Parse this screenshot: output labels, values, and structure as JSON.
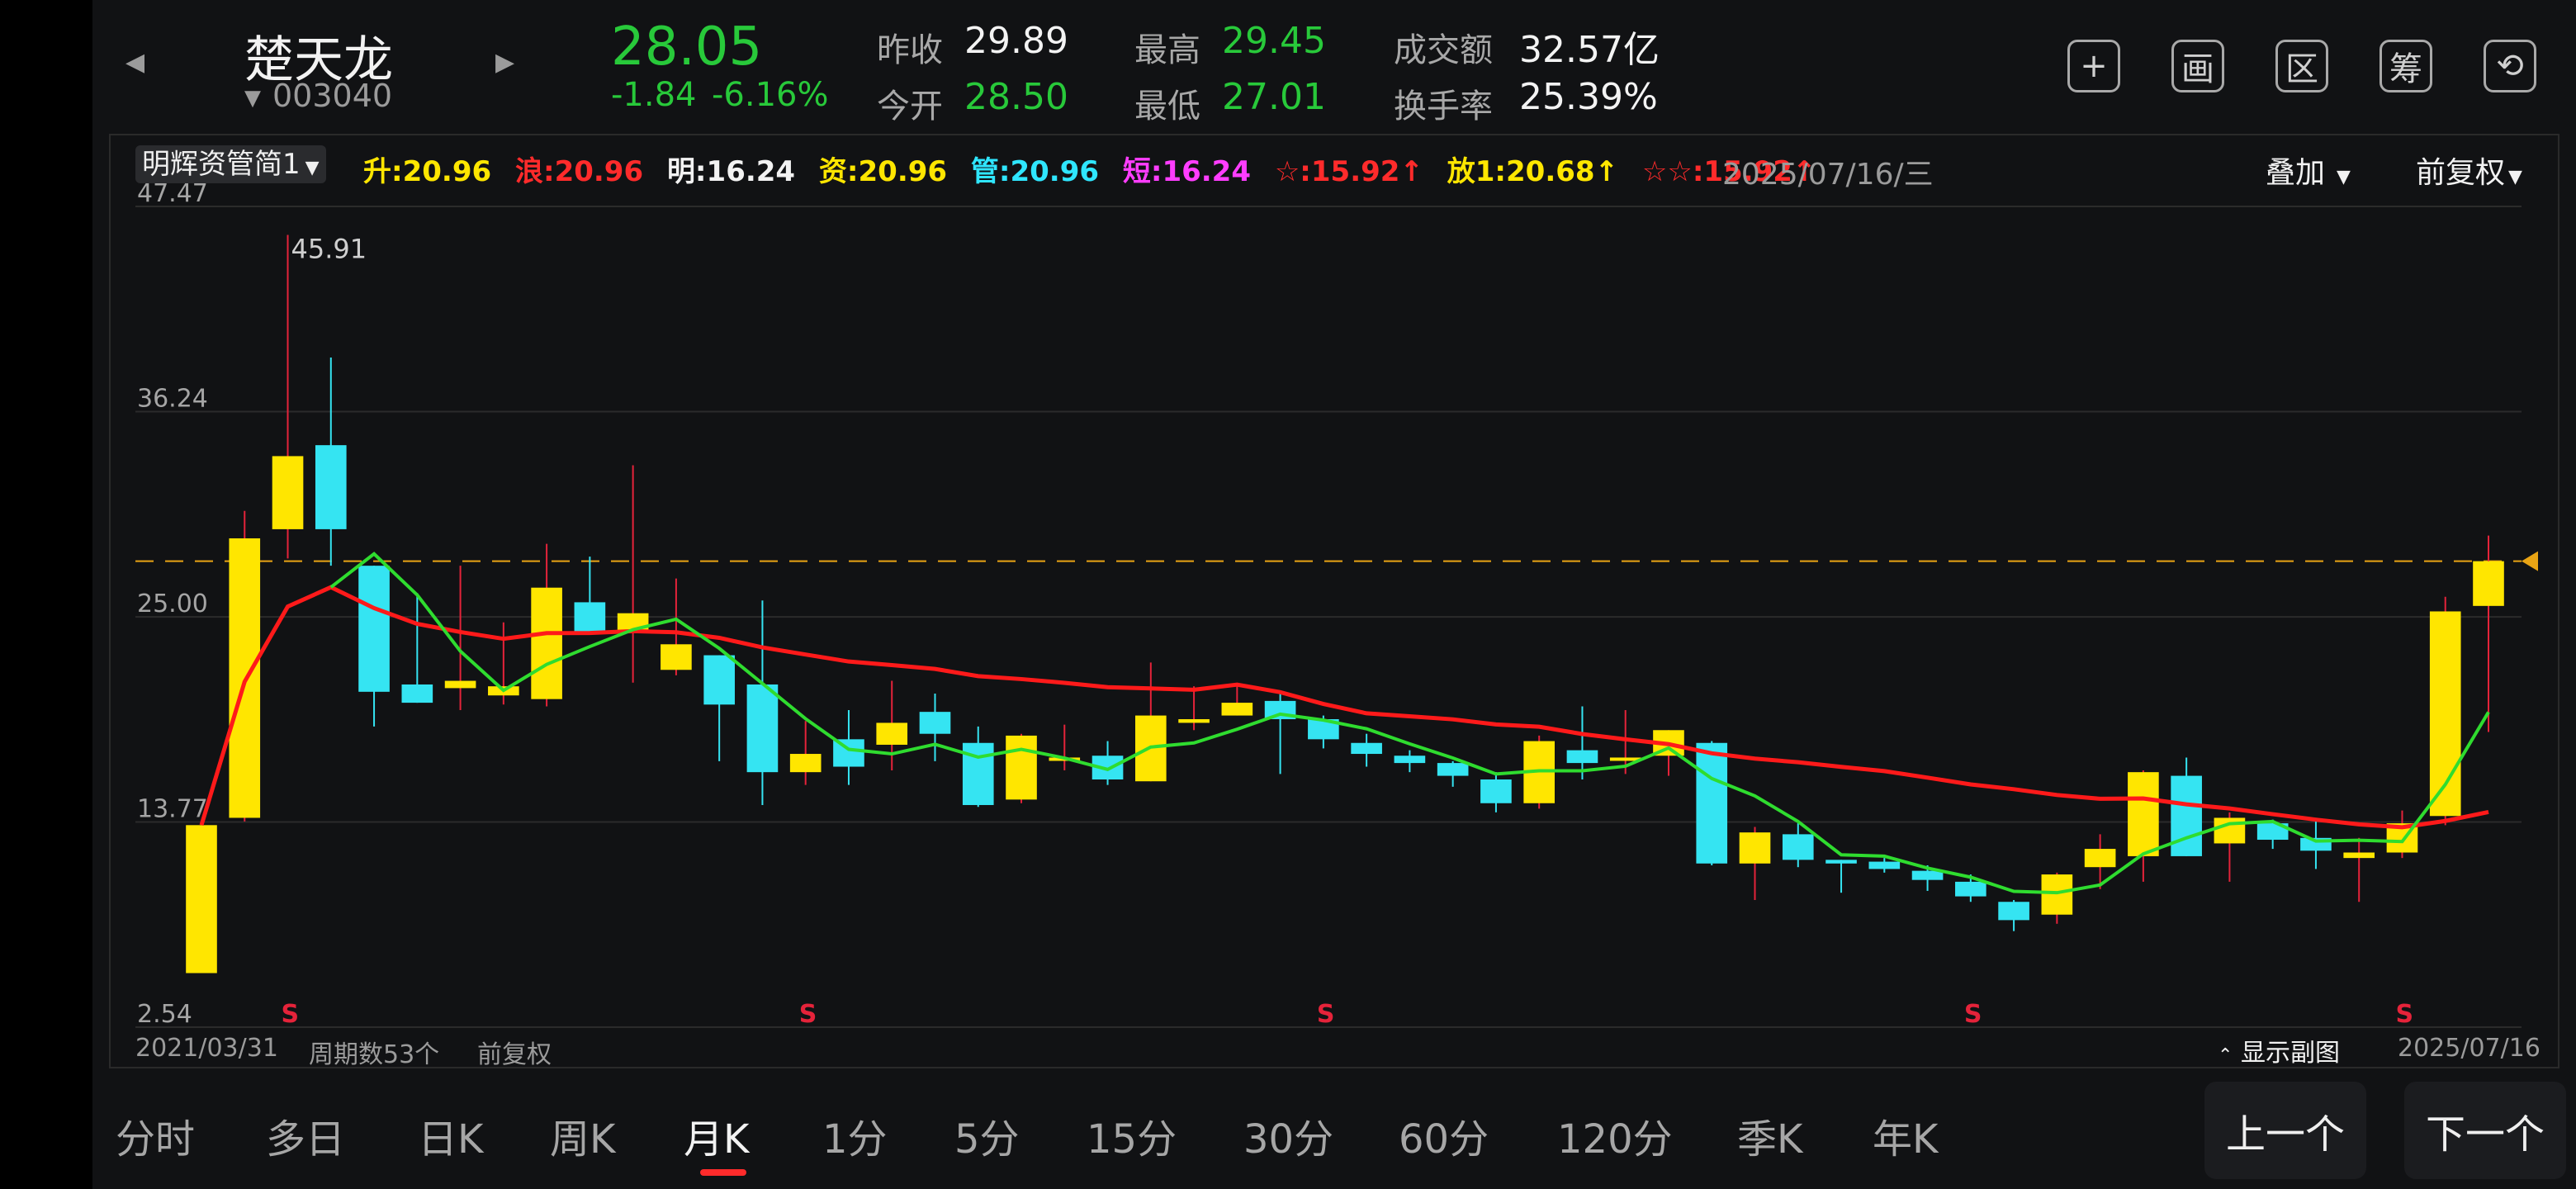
{
  "stock": {
    "name": "楚天龙",
    "code": "003040",
    "price": "28.05",
    "change": "-1.84",
    "change_pct": "-6.16%",
    "prev_close_label": "昨收",
    "prev_close": "29.89",
    "open_label": "今开",
    "open": "28.50",
    "high_label": "最高",
    "high": "29.45",
    "low_label": "最低",
    "low": "27.01",
    "turnover_label": "成交额",
    "turnover": "32.57亿",
    "turnover_rate_label": "换手率",
    "turnover_rate": "25.39%"
  },
  "header_icons": [
    {
      "name": "plus-icon",
      "glyph": "+"
    },
    {
      "name": "drawing-icon",
      "glyph": "画"
    },
    {
      "name": "range-icon",
      "glyph": "区"
    },
    {
      "name": "chip-icon",
      "glyph": "筹"
    },
    {
      "name": "rotate-screen-icon",
      "glyph": "⟲"
    }
  ],
  "indicator_bar": {
    "indicator_name": "明辉资管简1",
    "items": [
      {
        "label": "升:20.96",
        "color": "#ffe600"
      },
      {
        "label": "浪:20.96",
        "color": "#ff2b2b"
      },
      {
        "label": "明:16.24",
        "color": "#f2f2f2"
      },
      {
        "label": "资:20.96",
        "color": "#ffe600"
      },
      {
        "label": "管:20.96",
        "color": "#2fe6ff"
      },
      {
        "label": "短:16.24",
        "color": "#ff3dff"
      },
      {
        "label": "☆:15.92↑",
        "color": "#ff2b2b"
      },
      {
        "label": "放1:20.68↑",
        "color": "#ffe600"
      },
      {
        "label": "☆☆:15.92↑",
        "color": "#ff2b2b"
      }
    ],
    "date": "2025/07/16/三",
    "overlay_label": "叠加",
    "adjust_label": "前复权"
  },
  "chart_data": {
    "type": "candlestick",
    "y_ticks": [
      "47.47",
      "36.24",
      "25.00",
      "13.77",
      "2.54"
    ],
    "ylim": [
      2.54,
      47.47
    ],
    "x_start": "2021/03/31",
    "x_end": "2025/07/16",
    "period_count": "周期数53个",
    "adjust_mode": "前复权",
    "peak_annotation": "45.91",
    "current_price": 28.05,
    "sell_marker": "S",
    "sell_marker_indices": [
      2,
      14,
      26,
      41,
      51
    ],
    "sub_chart_toggle": "显示副图",
    "candles": [
      {
        "o": 5.5,
        "h": 13.6,
        "l": 5.5,
        "c": 13.6
      },
      {
        "o": 14.0,
        "h": 30.8,
        "l": 13.8,
        "c": 29.3
      },
      {
        "o": 29.8,
        "h": 45.91,
        "l": 28.2,
        "c": 33.8
      },
      {
        "o": 34.4,
        "h": 39.2,
        "l": 27.8,
        "c": 29.8
      },
      {
        "o": 27.8,
        "h": 27.8,
        "l": 19.0,
        "c": 20.9
      },
      {
        "o": 21.3,
        "h": 26.3,
        "l": 20.3,
        "c": 20.3
      },
      {
        "o": 21.1,
        "h": 27.8,
        "l": 19.9,
        "c": 21.5
      },
      {
        "o": 20.7,
        "h": 24.7,
        "l": 20.2,
        "c": 21.2
      },
      {
        "o": 20.5,
        "h": 29.0,
        "l": 20.1,
        "c": 26.6
      },
      {
        "o": 25.8,
        "h": 28.3,
        "l": 24.2,
        "c": 24.2
      },
      {
        "o": 24.2,
        "h": 33.3,
        "l": 21.4,
        "c": 25.2
      },
      {
        "o": 22.1,
        "h": 27.1,
        "l": 21.8,
        "c": 23.5
      },
      {
        "o": 22.9,
        "h": 22.9,
        "l": 17.1,
        "c": 20.2
      },
      {
        "o": 21.3,
        "h": 25.9,
        "l": 14.7,
        "c": 16.5
      },
      {
        "o": 16.5,
        "h": 19.3,
        "l": 15.8,
        "c": 17.5
      },
      {
        "o": 18.3,
        "h": 19.9,
        "l": 15.8,
        "c": 16.8
      },
      {
        "o": 18.0,
        "h": 21.5,
        "l": 16.6,
        "c": 19.2
      },
      {
        "o": 19.8,
        "h": 20.8,
        "l": 17.1,
        "c": 18.6
      },
      {
        "o": 18.1,
        "h": 19.0,
        "l": 14.6,
        "c": 14.7
      },
      {
        "o": 15.0,
        "h": 18.6,
        "l": 14.8,
        "c": 18.5
      },
      {
        "o": 17.2,
        "h": 19.1,
        "l": 16.6,
        "c": 17.3
      },
      {
        "o": 17.4,
        "h": 18.2,
        "l": 15.8,
        "c": 16.1
      },
      {
        "o": 16.0,
        "h": 22.5,
        "l": 16.0,
        "c": 19.6
      },
      {
        "o": 19.2,
        "h": 21.2,
        "l": 18.8,
        "c": 19.4
      },
      {
        "o": 19.6,
        "h": 21.2,
        "l": 19.6,
        "c": 20.3
      },
      {
        "o": 20.4,
        "h": 20.9,
        "l": 16.4,
        "c": 19.4
      },
      {
        "o": 19.4,
        "h": 19.6,
        "l": 17.8,
        "c": 18.3
      },
      {
        "o": 18.1,
        "h": 18.6,
        "l": 16.8,
        "c": 17.5
      },
      {
        "o": 17.4,
        "h": 17.7,
        "l": 16.5,
        "c": 17.0
      },
      {
        "o": 17.0,
        "h": 17.1,
        "l": 15.7,
        "c": 16.3
      },
      {
        "o": 16.1,
        "h": 16.5,
        "l": 14.3,
        "c": 14.8
      },
      {
        "o": 14.8,
        "h": 18.5,
        "l": 14.5,
        "c": 18.2
      },
      {
        "o": 17.7,
        "h": 20.1,
        "l": 16.1,
        "c": 17.0
      },
      {
        "o": 17.2,
        "h": 19.9,
        "l": 16.4,
        "c": 17.3
      },
      {
        "o": 17.4,
        "h": 18.8,
        "l": 16.3,
        "c": 18.8
      },
      {
        "o": 18.1,
        "h": 18.2,
        "l": 11.4,
        "c": 11.5
      },
      {
        "o": 11.5,
        "h": 13.5,
        "l": 9.5,
        "c": 13.2
      },
      {
        "o": 13.1,
        "h": 13.7,
        "l": 11.3,
        "c": 11.7
      },
      {
        "o": 11.7,
        "h": 11.7,
        "l": 9.9,
        "c": 11.5
      },
      {
        "o": 11.6,
        "h": 11.8,
        "l": 11.0,
        "c": 11.2
      },
      {
        "o": 11.1,
        "h": 11.4,
        "l": 10.0,
        "c": 10.6
      },
      {
        "o": 10.5,
        "h": 10.9,
        "l": 9.4,
        "c": 9.7
      },
      {
        "o": 9.4,
        "h": 9.5,
        "l": 7.8,
        "c": 8.4
      },
      {
        "o": 8.7,
        "h": 11.0,
        "l": 8.2,
        "c": 10.9
      },
      {
        "o": 11.3,
        "h": 13.1,
        "l": 10.1,
        "c": 12.3
      },
      {
        "o": 11.9,
        "h": 16.6,
        "l": 10.5,
        "c": 16.5
      },
      {
        "o": 16.3,
        "h": 17.3,
        "l": 11.9,
        "c": 11.9
      },
      {
        "o": 12.6,
        "h": 14.3,
        "l": 10.5,
        "c": 14.0
      },
      {
        "o": 13.7,
        "h": 13.9,
        "l": 12.3,
        "c": 12.8
      },
      {
        "o": 12.9,
        "h": 14.0,
        "l": 11.2,
        "c": 12.2
      },
      {
        "o": 11.8,
        "h": 12.9,
        "l": 9.4,
        "c": 12.1
      },
      {
        "o": 12.1,
        "h": 14.4,
        "l": 11.8,
        "c": 13.7
      },
      {
        "o": 14.1,
        "h": 26.1,
        "l": 13.6,
        "c": 25.3
      },
      {
        "o": 25.6,
        "h": 29.45,
        "l": 18.7,
        "c": 28.05
      }
    ]
  },
  "timeframes": [
    "分时",
    "多日",
    "日K",
    "周K",
    "月K",
    "1分",
    "5分",
    "15分",
    "30分",
    "60分",
    "120分",
    "季K",
    "年K"
  ],
  "active_timeframe": "月K",
  "nav": {
    "prev": "上一个",
    "next": "下一个"
  }
}
